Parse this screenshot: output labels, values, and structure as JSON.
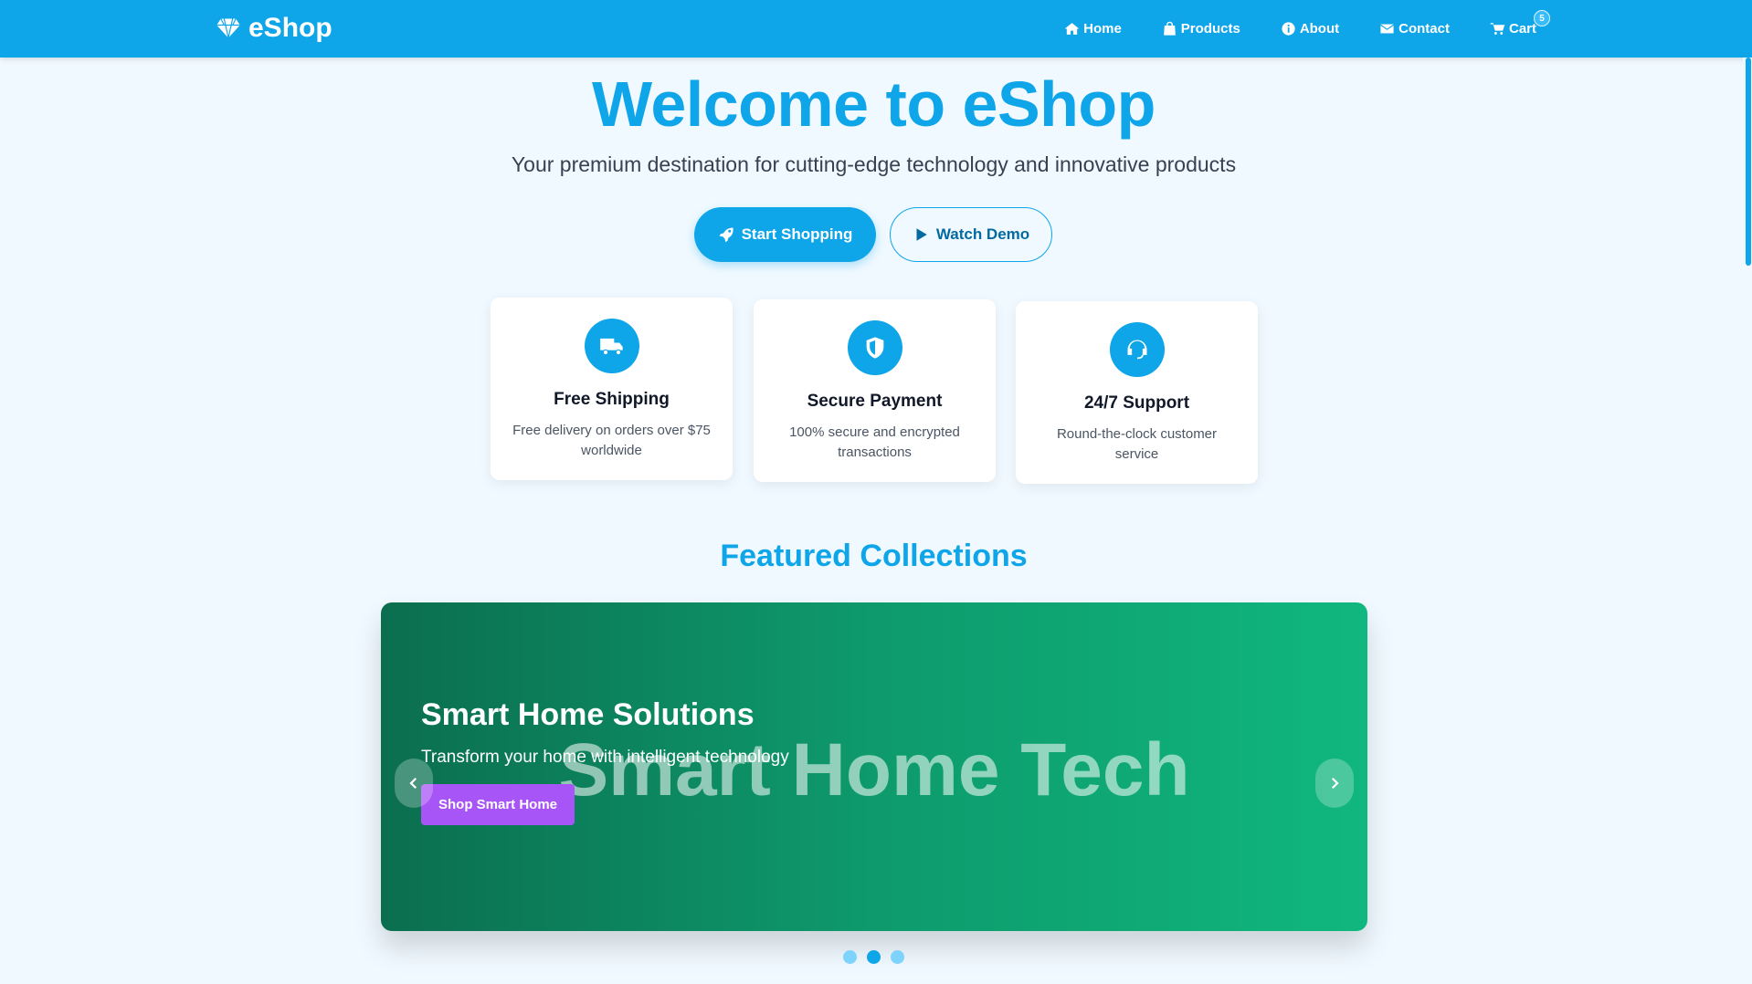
{
  "brand": {
    "name": "eShop",
    "icon": "diamond-icon"
  },
  "nav": {
    "items": [
      {
        "label": "Home",
        "icon": "home-icon"
      },
      {
        "label": "Products",
        "icon": "shopping-bag-icon"
      },
      {
        "label": "About",
        "icon": "info-icon"
      },
      {
        "label": "Contact",
        "icon": "envelope-icon"
      },
      {
        "label": "Cart",
        "icon": "cart-icon",
        "badge": "5"
      }
    ]
  },
  "hero": {
    "title": "Welcome to eShop",
    "subtitle": "Your premium destination for cutting-edge technology and innovative products",
    "primary_button": "Start Shopping",
    "secondary_button": "Watch Demo"
  },
  "features": [
    {
      "title": "Free Shipping",
      "description": "Free delivery on orders over $75 worldwide",
      "icon": "truck-icon"
    },
    {
      "title": "Secure Payment",
      "description": "100% secure and encrypted transactions",
      "icon": "shield-icon"
    },
    {
      "title": "24/7 Support",
      "description": "Round-the-clock customer service",
      "icon": "headset-icon"
    }
  ],
  "featured": {
    "title": "Featured Collections",
    "slide": {
      "background_text": "Smart Home Tech",
      "title": "Smart Home Solutions",
      "description": "Transform your home with intelligent technology",
      "button": "Shop Smart Home"
    },
    "dots": {
      "count": 3,
      "active_index": 1
    }
  },
  "colors": {
    "primary": "#0ea5e9",
    "page_background": "#f0f9ff",
    "slide_gradient_start": "#0b6e4f",
    "slide_gradient_end": "#10b77f",
    "slide_button": "#a855f7"
  }
}
